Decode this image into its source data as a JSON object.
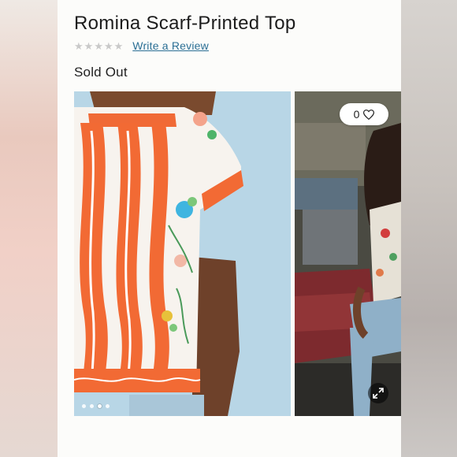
{
  "product": {
    "title": "Romina Scarf-Printed Top",
    "rating_stars": 5,
    "review_link": "Write a Review",
    "stock_status": "Sold Out"
  },
  "gallery": {
    "like_count": "0",
    "slide_count": 4,
    "active_slide": 3
  },
  "icons": {
    "like": "heart-icon",
    "expand": "expand-icon",
    "rating": "star-icon"
  },
  "colors": {
    "link": "#2b6f95",
    "star_empty": "#c9c9c9"
  }
}
